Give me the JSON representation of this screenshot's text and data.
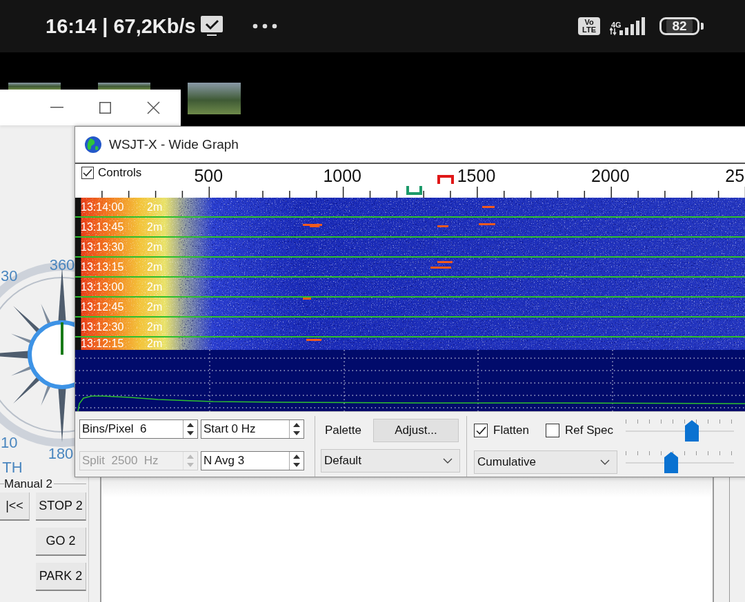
{
  "status_bar": {
    "clock_text": "16:14 | 67,2Kb/s",
    "volte": "Vo LTE",
    "network": "4G",
    "battery": "82"
  },
  "rotator_window": {
    "compass_labels": [
      "360",
      "30",
      "10",
      "180",
      "TH"
    ],
    "group_title": "Manual 2",
    "buttons": [
      {
        "label": "|<<",
        "kind": "small"
      },
      {
        "label": "STOP 2",
        "kind": "wide"
      },
      {
        "label": "GO 2",
        "kind": "wide"
      },
      {
        "label": "PARK 2",
        "kind": "wide"
      }
    ]
  },
  "wide_graph": {
    "title": "WSJT-X - Wide Graph",
    "controls_checkbox": {
      "label": "Controls",
      "checked": true
    },
    "scale_labels": [
      "500",
      "1000",
      "1500",
      "2000",
      "25"
    ],
    "waterfall_labels": [
      {
        "time": "13:14:00",
        "mode": "2m"
      },
      {
        "time": "13:13:45",
        "mode": "2m"
      },
      {
        "time": "13:13:30",
        "mode": "2m"
      },
      {
        "time": "13:13:15",
        "mode": "2m"
      },
      {
        "time": "13:13:00",
        "mode": "2m"
      },
      {
        "time": "13:12:45",
        "mode": "2m"
      },
      {
        "time": "13:12:30",
        "mode": "2m"
      },
      {
        "time": "13:12:15",
        "mode": "2m"
      }
    ],
    "spinboxes": [
      {
        "text": "Bins/Pixel  6",
        "disabled": false
      },
      {
        "text": "Start 0 Hz",
        "disabled": false
      },
      {
        "text": "Split  2500  Hz",
        "disabled": true
      },
      {
        "text": "N Avg 3",
        "disabled": false
      }
    ],
    "palette_label": "Palette",
    "adjust_button": "Adjust...",
    "palette_select": "Default",
    "flatten": {
      "label": "Flatten",
      "checked": true
    },
    "ref_spec": {
      "label": "Ref Spec",
      "checked": false
    },
    "spectrum_select": "Cumulative",
    "sliders": [
      {
        "level": 0.61
      },
      {
        "level": 0.42
      }
    ]
  }
}
